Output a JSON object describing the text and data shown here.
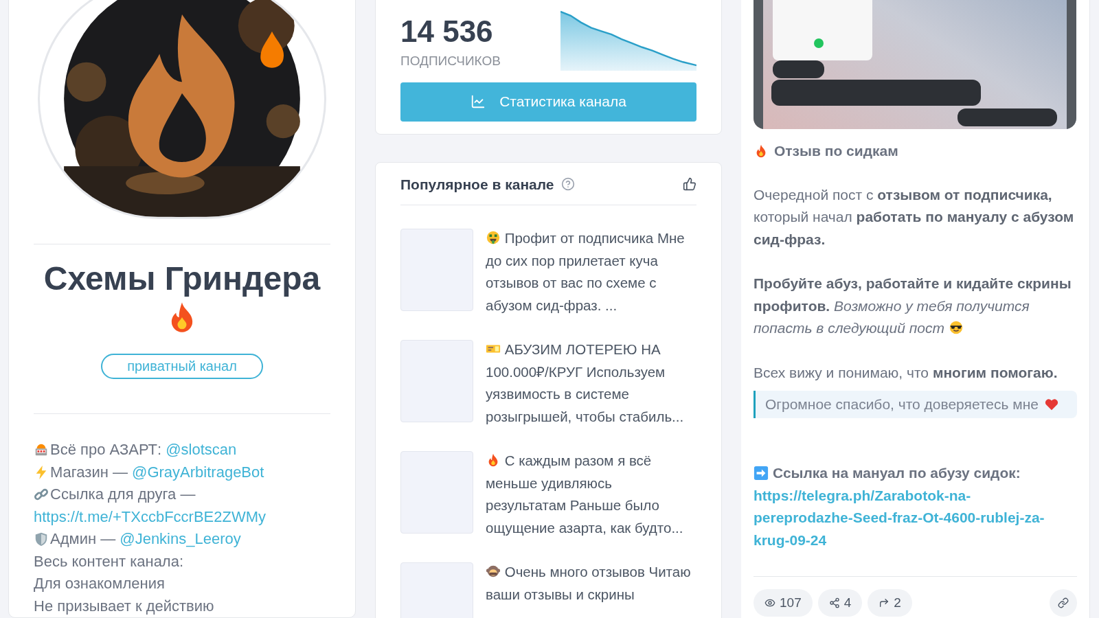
{
  "channel": {
    "title": "Схемы Гриндера",
    "badge": "приватный канал",
    "description": [
      {
        "kind": "slot",
        "text": "Всё про АЗАРТ: ",
        "link": "@slotscan"
      },
      {
        "kind": "bolt",
        "text": "Магазин — ",
        "link": "@GrayArbitrageBot"
      },
      {
        "kind": "chain",
        "text": "Ссылка для друга —"
      },
      {
        "kind": "none",
        "link": "https://t.me/+TXccbFccrBE2ZWMy"
      },
      {
        "kind": "shield",
        "text": "Админ — ",
        "link": "@Jenkins_Leeroy"
      },
      {
        "kind": "none",
        "text": "Весь контент канала:"
      },
      {
        "kind": "none",
        "text": "Для ознакомления"
      },
      {
        "kind": "none",
        "text": "Не призывает к действию"
      }
    ]
  },
  "stats": {
    "subscribers": "14 536",
    "subscribers_label": "ПОДПИСЧИКОВ",
    "button": "Статистика канала"
  },
  "popular": {
    "title": "Популярное в канале",
    "items": [
      {
        "kind": "money",
        "text": "Профит от подписчика Мне до сих пор прилетает куча отзывов от вас по схеме с абузом сид-фраз. ..."
      },
      {
        "kind": "ticket",
        "text": "АБУЗИМ ЛОТЕРЕЮ НА 100.000₽/КРУГ Используем уязвимость в системе розыгрышей, чтобы стабиль..."
      },
      {
        "kind": "fire",
        "text": "С каждым разом я всё меньше удивляюсь результатам Раньше было ощущение азарта, как будто..."
      },
      {
        "kind": "monkey",
        "text": "Очень много отзывов Читаю ваши отзывы и скрины"
      }
    ]
  },
  "post": {
    "title": "Отзыв по сидкам",
    "paragraphs": [
      {
        "kind": "plain",
        "text": "Очередной пост с **отзывом от подписчика,** который начал **работать по мануалу с абузом сид-фраз.**"
      },
      {
        "kind": "sunglasses",
        "text": "**Пробуйте абуз, работайте и кидайте скрины профитов.** *Возможно у тебя получится попасть в следующий пост*"
      },
      {
        "kind": "plain",
        "text": "Всех вижу и понимаю, что **многим помогаю.**"
      }
    ],
    "quote": "Огромное спасибо, что доверяетесь мне",
    "link_label": "Ссылка на мануал по абузу сидок:",
    "link": "https://telegra.ph/Zarabotok-na-pereprodazhe-Seed-fraz-Ot-4600-rublej-za-krug-09-24",
    "views": "107",
    "shares": "4",
    "forwards": "2"
  }
}
